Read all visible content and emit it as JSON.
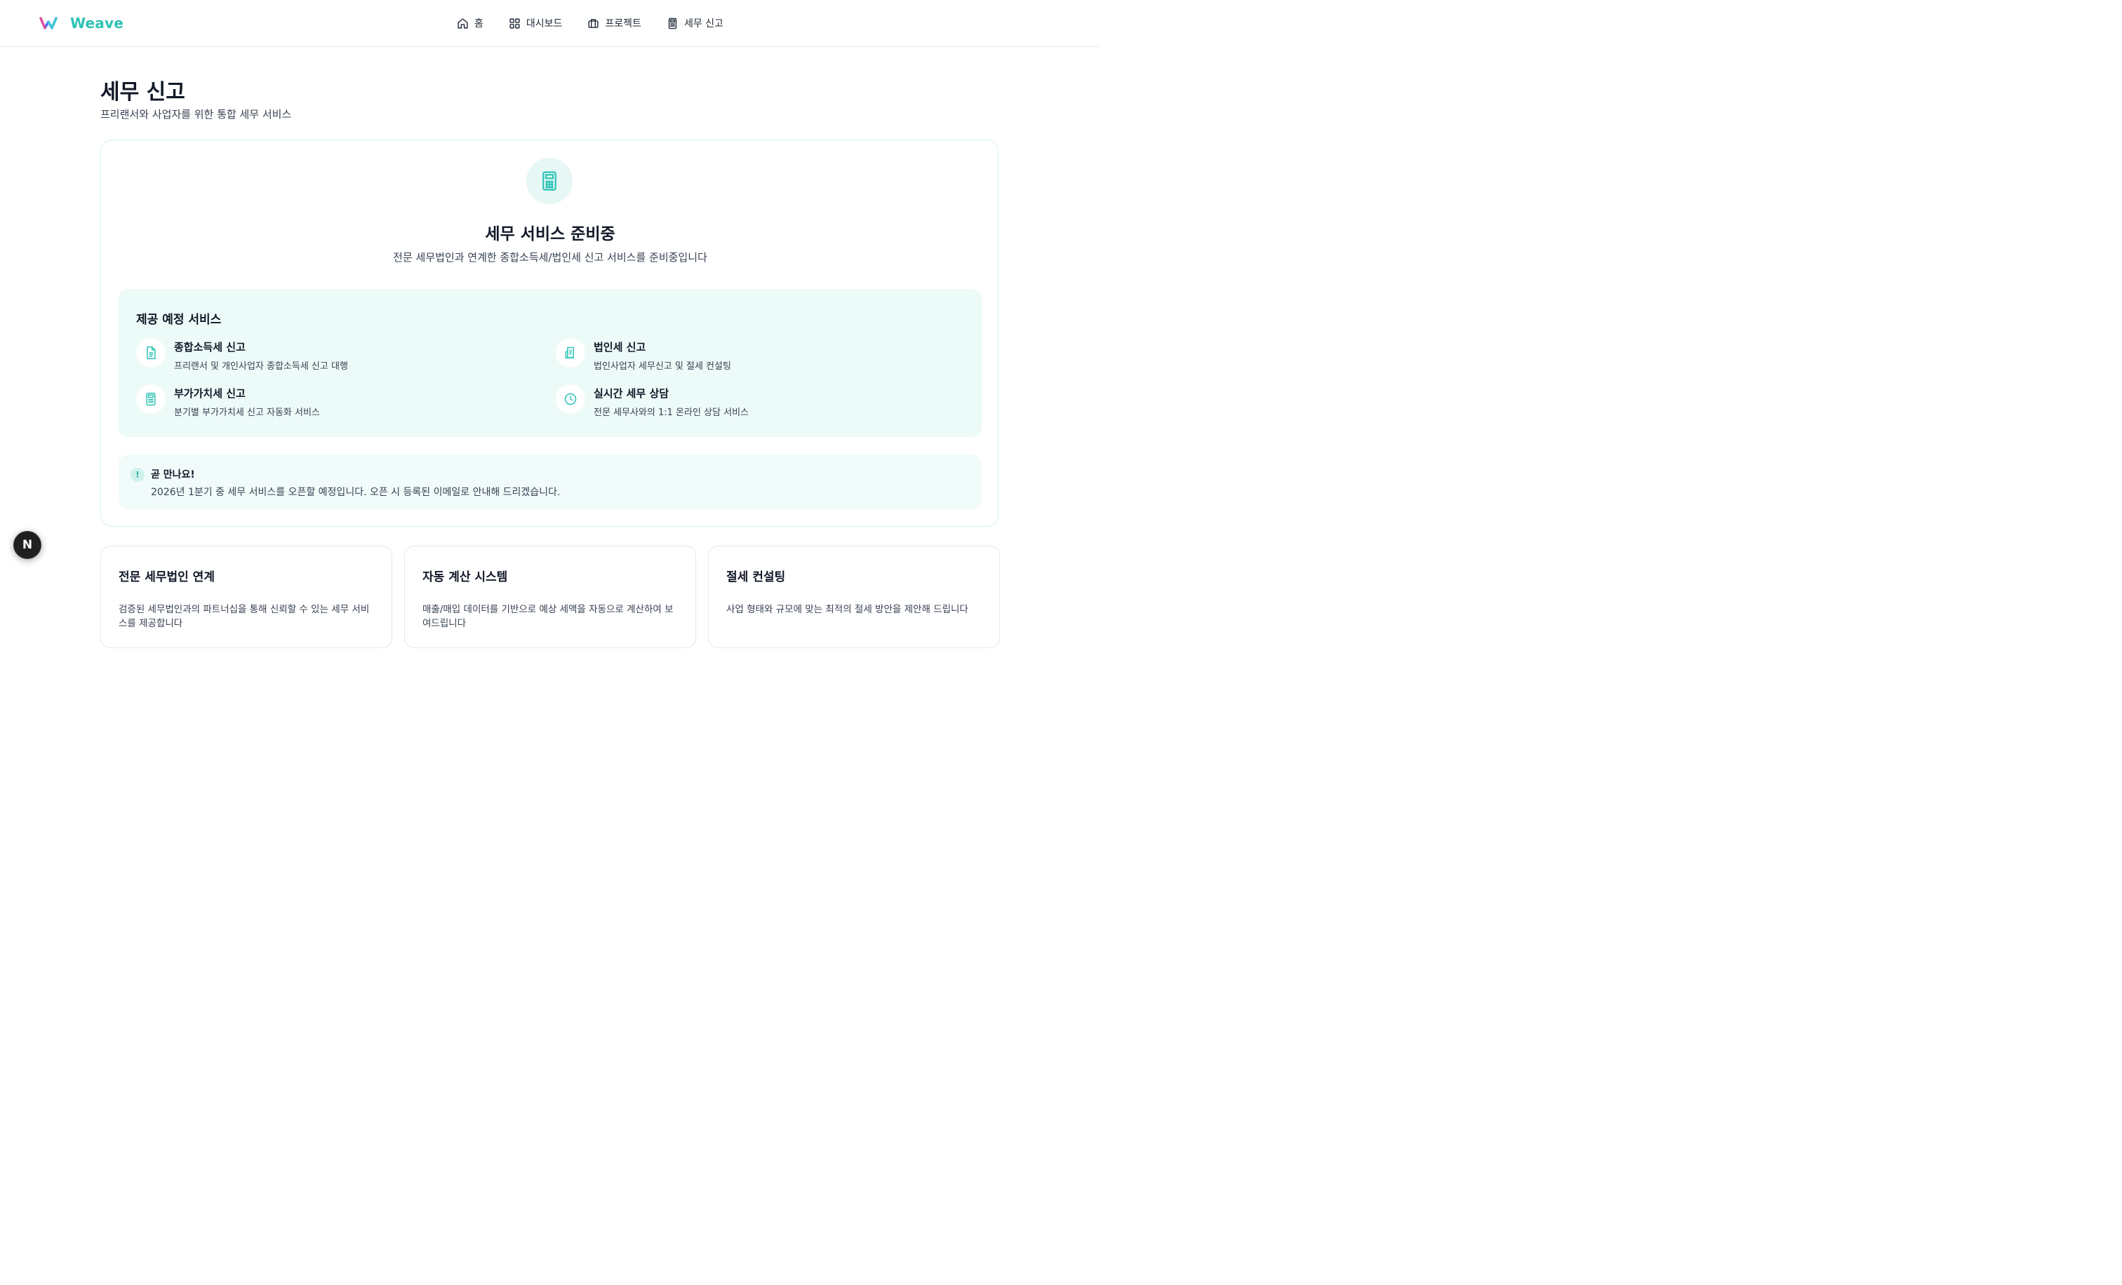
{
  "header": {
    "logo_text": "Weave",
    "nav": [
      {
        "label": "홈",
        "icon": "home-icon"
      },
      {
        "label": "대시보드",
        "icon": "dashboard-icon"
      },
      {
        "label": "프로젝트",
        "icon": "briefcase-icon"
      },
      {
        "label": "세무 신고",
        "icon": "calculator-icon"
      }
    ]
  },
  "page": {
    "title": "세무 신고",
    "subtitle": "프리랜서와 사업자를 위한 통합 세무 서비스"
  },
  "hero": {
    "icon": "calculator-icon",
    "title": "세무 서비스 준비중",
    "subtitle": "전문 세무법인과 연계한 종합소득세/법인세 신고 서비스를 준비중입니다"
  },
  "services": {
    "title": "제공 예정 서비스",
    "items": [
      {
        "title": "종합소득세 신고",
        "desc": "프리랜서 및 개인사업자 종합소득세 신고 대행",
        "icon": "file-text-icon"
      },
      {
        "title": "법인세 신고",
        "desc": "법인사업자 세무신고 및 절세 컨설팅",
        "icon": "receipt-icon"
      },
      {
        "title": "부가가치세 신고",
        "desc": "분기별 부가가치세 신고 자동화 서비스",
        "icon": "calculator-icon"
      },
      {
        "title": "실시간 세무 상담",
        "desc": "전문 세무사와의 1:1 온라인 상담 서비스",
        "icon": "clock-icon"
      }
    ]
  },
  "notice": {
    "icon_glyph": "!",
    "title": "곧 만나요!",
    "text": "2026년 1분기 중 세무 서비스를 오픈할 예정입니다. 오픈 시 등록된 이메일로 안내해 드리겠습니다."
  },
  "features": [
    {
      "title": "전문 세무법인 연계",
      "desc": "검증된 세무법인과의 파트너십을 통해 신뢰할 수 있는 세무 서비스를 제공합니다"
    },
    {
      "title": "자동 계산 시스템",
      "desc": "매출/매입 데이터를 기반으로 예상 세액을 자동으로 계산하여 보여드립니다"
    },
    {
      "title": "절세 컨설팅",
      "desc": "사업 형태와 규모에 맞는 최적의 절세 방안을 제안해 드립니다"
    }
  ],
  "fab": {
    "label": "N"
  },
  "colors": {
    "accent": "#2dc3b5",
    "accent_bg": "#ecfaf8",
    "text": "#111827"
  }
}
